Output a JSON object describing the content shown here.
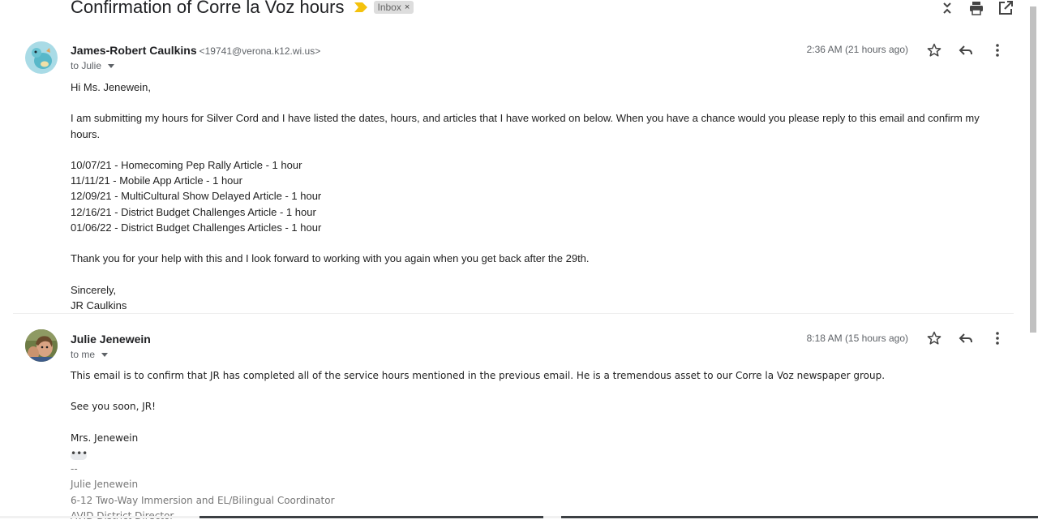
{
  "thread": {
    "subject": "Confirmation of Corre la Voz hours",
    "label": "Inbox",
    "label_remove": "×",
    "important_color": "#f4c20d"
  },
  "toolbar": {
    "icons": [
      "collapse-all-icon",
      "print-icon",
      "open-in-new-window-icon"
    ]
  },
  "messages": [
    {
      "sender_name": "James-Robert Caulkins",
      "sender_email": "<19741@verona.k12.wi.us>",
      "recipient": "to Julie",
      "time": "2:36 AM (21 hours ago)",
      "body": {
        "greeting": "Hi Ms. Jenewein,",
        "para1": "I am submitting my hours for Silver Cord and I have listed the dates, hours, and articles that I have worked on below.  When you have a chance would you please reply to this email and confirm my hours.",
        "entries": [
          "10/07/21 - Homecoming Pep Rally Article - 1 hour",
          "11/11/21 - Mobile App Article - 1 hour",
          "12/09/21 - MultiCultural Show Delayed Article - 1 hour",
          "12/16/21 - District Budget Challenges Article - 1 hour",
          "01/06/22 - District Budget Challenges Articles - 1 hour"
        ],
        "thanks": "Thank you for your help with this and I look forward to working with you again when you get back after the 29th.",
        "closing": "Sincerely,",
        "signoff": "JR Caulkins"
      }
    },
    {
      "sender_name": "Julie Jenewein",
      "recipient": "to me",
      "time": "8:18 AM (15 hours ago)",
      "body": {
        "para1": "This email is to confirm that JR has completed all of the service hours mentioned in the previous email. He is a tremendous asset to our Corre la Voz newspaper group.",
        "para2": "See you soon, JR!",
        "closing": "Mrs. Jenewein",
        "ellipsis": "•••",
        "sig_sep": "--",
        "sig_name": "Julie Jenewein",
        "sig_title": "6-12 Two-Way Immersion and EL/Bilingual Coordinator",
        "sig_title2": "AVID District Director"
      }
    }
  ]
}
